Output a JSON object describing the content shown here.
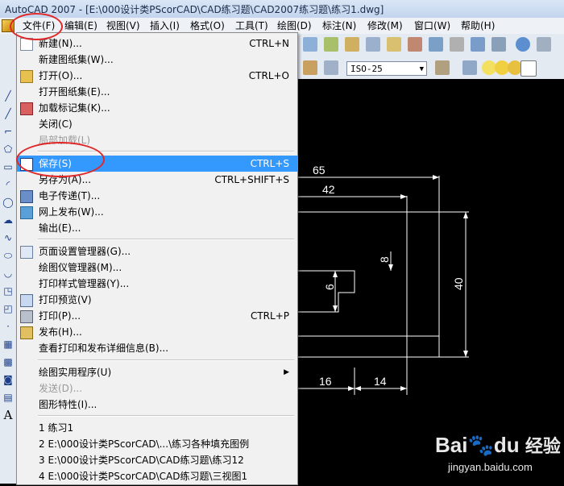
{
  "window": {
    "title": "AutoCAD 2007 - [E:\\000设计类PScorCAD\\CAD练习题\\CAD2007练习题\\练习1.dwg]"
  },
  "menubar": {
    "items": [
      "文件(F)",
      "编辑(E)",
      "视图(V)",
      "插入(I)",
      "格式(O)",
      "工具(T)",
      "绘图(D)",
      "标注(N)",
      "修改(M)",
      "窗口(W)",
      "帮助(H)"
    ]
  },
  "toolbar": {
    "dimstyle_value": "ISO-25"
  },
  "file_menu": {
    "items": [
      {
        "label": "新建(N)...",
        "shortcut": "CTRL+N",
        "icon": "new-file-icon"
      },
      {
        "label": "新建图纸集(W)...",
        "shortcut": ""
      },
      {
        "label": "打开(O)...",
        "shortcut": "CTRL+O",
        "icon": "open-folder-icon"
      },
      {
        "label": "打开图纸集(E)...",
        "shortcut": ""
      },
      {
        "label": "加载标记集(K)...",
        "shortcut": "",
        "icon": "markup-icon"
      },
      {
        "label": "关闭(C)",
        "shortcut": ""
      },
      {
        "label": "局部加载(L)",
        "shortcut": "",
        "disabled": true
      },
      {
        "label": "保存(S)",
        "shortcut": "CTRL+S",
        "icon": "save-icon",
        "highlighted": true
      },
      {
        "label": "另存为(A)...",
        "shortcut": "CTRL+SHIFT+S"
      },
      {
        "label": "电子传递(T)...",
        "shortcut": "",
        "icon": "etransmit-icon"
      },
      {
        "label": "网上发布(W)...",
        "shortcut": "",
        "icon": "publish-web-icon"
      },
      {
        "label": "输出(E)...",
        "shortcut": ""
      },
      {
        "label": "页面设置管理器(G)...",
        "shortcut": "",
        "icon": "page-setup-icon"
      },
      {
        "label": "绘图仪管理器(M)...",
        "shortcut": ""
      },
      {
        "label": "打印样式管理器(Y)...",
        "shortcut": ""
      },
      {
        "label": "打印预览(V)",
        "shortcut": "",
        "icon": "print-preview-icon"
      },
      {
        "label": "打印(P)...",
        "shortcut": "CTRL+P",
        "icon": "print-icon"
      },
      {
        "label": "发布(H)...",
        "shortcut": "",
        "icon": "publish-icon"
      },
      {
        "label": "查看打印和发布详细信息(B)...",
        "shortcut": ""
      },
      {
        "label": "绘图实用程序(U)",
        "shortcut": "",
        "submenu": true
      },
      {
        "label": "发送(D)...",
        "shortcut": "",
        "disabled": true
      },
      {
        "label": "图形特性(I)...",
        "shortcut": ""
      },
      {
        "label": "1 练习1",
        "shortcut": ""
      },
      {
        "label": "2 E:\\000设计类PScorCAD\\...\\练习各种填充图例",
        "shortcut": ""
      },
      {
        "label": "3 E:\\000设计类PScorCAD\\CAD练习题\\练习12",
        "shortcut": ""
      },
      {
        "label": "4 E:\\000设计类PScorCAD\\CAD练习题\\三视图1",
        "shortcut": ""
      }
    ]
  },
  "drawing": {
    "dims": [
      "65",
      "42",
      "8",
      "6",
      "40",
      "16",
      "14"
    ]
  },
  "watermark": {
    "brand": "Bai",
    "brand_mid": "du",
    "brand_cn": "经验",
    "url": "jingyan.baidu.com"
  },
  "colors": {
    "highlight": "#3399ff",
    "annotation": "#e02828",
    "canvas": "#000000"
  }
}
